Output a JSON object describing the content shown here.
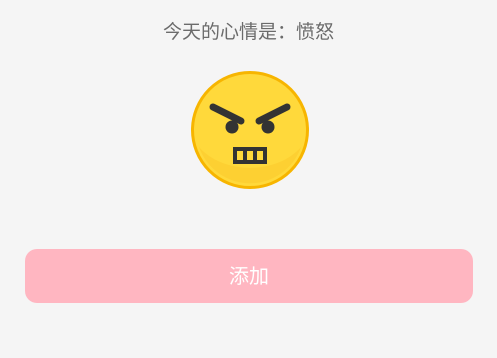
{
  "header": {
    "mood_text": "今天的心情是：愤怒"
  },
  "mood": {
    "icon": "angry-face-icon",
    "face_color": "#ffd93b",
    "outline_color": "#f7b500",
    "feature_color": "#333333"
  },
  "actions": {
    "add_label": "添加",
    "add_color": "#ffb6c1"
  },
  "theme": {
    "background": "#f5f5f5",
    "text_color": "#6b6b6b"
  }
}
